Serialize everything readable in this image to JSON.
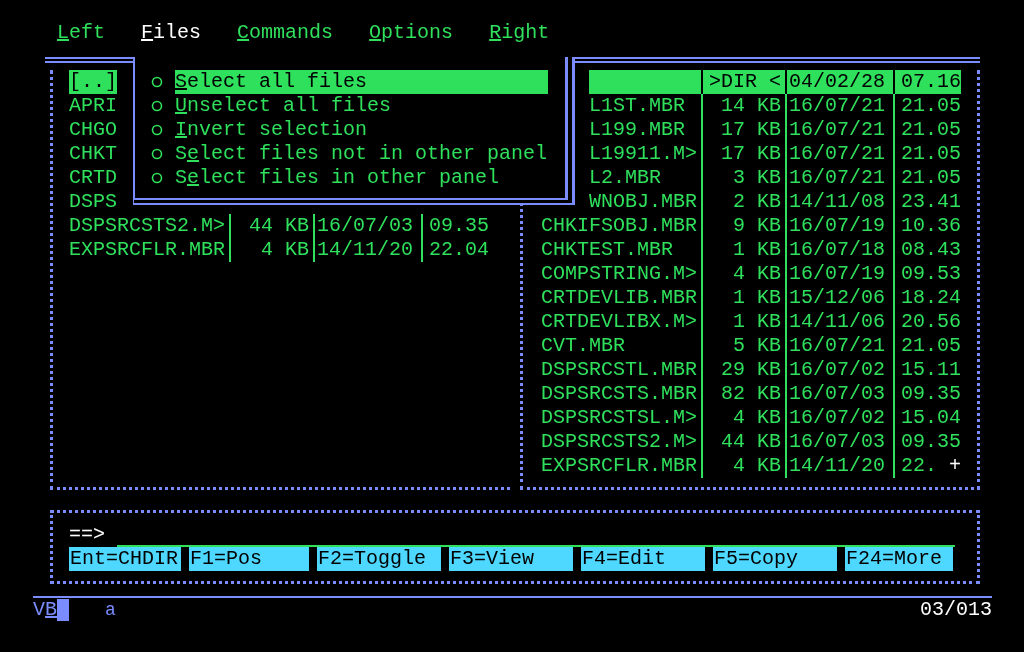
{
  "menu_bar": [
    {
      "key": "L",
      "rest": "eft",
      "selected": false
    },
    {
      "key": "F",
      "rest": "iles",
      "selected": true
    },
    {
      "key": "C",
      "rest": "ommands",
      "selected": false
    },
    {
      "key": "O",
      "rest": "ptions",
      "selected": false
    },
    {
      "key": "R",
      "rest": "ight",
      "selected": false
    }
  ],
  "dropdown": [
    {
      "key": "S",
      "after": "elect all files",
      "selected": true
    },
    {
      "key": "U",
      "after": "nselect all files",
      "selected": false
    },
    {
      "key": "I",
      "after": "nvert selection",
      "selected": false
    },
    {
      "before": "S",
      "key": "e",
      "after": "lect files not in other panel",
      "selected": false
    },
    {
      "before": "S",
      "key": "e",
      "after": "lect files in other panel",
      "selected": false
    }
  ],
  "left_panel": {
    "active": false,
    "rows": [
      {
        "name": "[..]",
        "selected": true
      },
      {
        "name": "APRI",
        "selected": false
      },
      {
        "name": "CHGO",
        "selected": false
      },
      {
        "name": "CHKT",
        "selected": false
      },
      {
        "name": "CRTD",
        "selected": false
      },
      {
        "name": "DSPS",
        "selected": false
      },
      {
        "name": "DSPSRCSTS2.M>",
        "size": "44 KB",
        "date": "16/07/03",
        "time": "09.35",
        "selected": false
      },
      {
        "name": "EXPSRCFLR.MBR",
        "size": "4 KB",
        "date": "14/11/20",
        "time": "22.04",
        "selected": false
      }
    ]
  },
  "right_panel": {
    "active": true,
    "rows": [
      {
        "size": ">DIR <",
        "date": "04/02/28",
        "time": "07.16",
        "selected": true
      },
      {
        "name": "L1ST.MBR",
        "size": "14 KB",
        "date": "16/07/21",
        "time": "21.05",
        "selected": false
      },
      {
        "name": "L199.MBR",
        "size": "17 KB",
        "date": "16/07/21",
        "time": "21.05",
        "selected": false
      },
      {
        "name": "L19911.M>",
        "size": "17 KB",
        "date": "16/07/21",
        "time": "21.05",
        "selected": false
      },
      {
        "name": "L2.MBR",
        "size": "3 KB",
        "date": "16/07/21",
        "time": "21.05",
        "selected": false
      },
      {
        "name": "WNOBJ.MBR",
        "size": "2 KB",
        "date": "14/11/08",
        "time": "23.41",
        "selected": false
      },
      {
        "name": "CHKIFSOBJ.MBR",
        "size": "9 KB",
        "date": "16/07/19",
        "time": "10.36",
        "selected": false
      },
      {
        "name": "CHKTEST.MBR",
        "size": "1 KB",
        "date": "16/07/18",
        "time": "08.43",
        "selected": false
      },
      {
        "name": "COMPSTRING.M>",
        "size": "4 KB",
        "date": "16/07/19",
        "time": "09.53",
        "selected": false
      },
      {
        "name": "CRTDEVLIB.MBR",
        "size": "1 KB",
        "date": "15/12/06",
        "time": "18.24",
        "selected": false
      },
      {
        "name": "CRTDEVLIBX.M>",
        "size": "1 KB",
        "date": "14/11/06",
        "time": "20.56",
        "selected": false
      },
      {
        "name": "CVT.MBR",
        "size": "5 KB",
        "date": "16/07/21",
        "time": "21.05",
        "selected": false
      },
      {
        "name": "DSPSRCSTL.MBR",
        "size": "29 KB",
        "date": "16/07/02",
        "time": "15.11",
        "selected": false
      },
      {
        "name": "DSPSRCSTS.MBR",
        "size": "82 KB",
        "date": "16/07/03",
        "time": "09.35",
        "selected": false
      },
      {
        "name": "DSPSRCSTSL.M>",
        "size": "4 KB",
        "date": "16/07/02",
        "time": "15.04",
        "selected": false
      },
      {
        "name": "DSPSRCSTS2.M>",
        "size": "44 KB",
        "date": "16/07/03",
        "time": "09.35",
        "selected": false
      },
      {
        "name": "EXPSRCFLR.MBR",
        "size": "4 KB",
        "date": "14/11/20",
        "time": "22.",
        "cursor": "+",
        "selected": false
      }
    ]
  },
  "command_line": {
    "prompt": "==>"
  },
  "function_keys": [
    "Ent=CHDIR",
    "F1=Pos",
    "F2=Toggle",
    "F3=View",
    "F4=Edit",
    "F5=Copy",
    "F24=More"
  ],
  "status_bar": {
    "mode": {
      "before": "V",
      "key": "B"
    },
    "field": "a",
    "position": "03/013"
  }
}
